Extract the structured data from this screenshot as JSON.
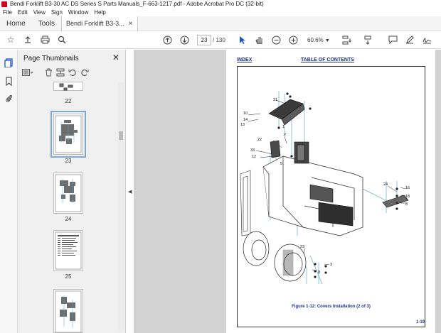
{
  "window": {
    "title": "Bendi Forklift  B3-30 AC DS Series S Parts Manuals_F-663-1217.pdf - Adobe Acrobat Pro DC (32-bit)"
  },
  "menu": [
    "File",
    "Edit",
    "View",
    "Sign",
    "Window",
    "Help"
  ],
  "tabs": {
    "home": "Home",
    "tools": "Tools",
    "doc": "Bendi Forklift  B3-3..."
  },
  "toolbar": {
    "page_current": "23",
    "page_total": "/   130",
    "zoom": "60.6%"
  },
  "panel": {
    "title": "Page Thumbnails",
    "thumbnails": [
      {
        "label": "22",
        "selected": false
      },
      {
        "label": "23",
        "selected": true
      },
      {
        "label": "24",
        "selected": false
      },
      {
        "label": "25",
        "selected": false
      },
      {
        "label": "",
        "selected": false
      }
    ]
  },
  "document": {
    "index_link": "INDEX",
    "toc_link": "TABLE OF CONTENTS",
    "caption": "Figure 1-12:  Covers Installation (2 of 3)",
    "page_number": "1-19",
    "callouts": [
      "31",
      "10",
      "14",
      "13",
      "1",
      "2",
      "22",
      "33",
      "12",
      "5",
      "24",
      "16",
      "18",
      "8",
      "23",
      "8",
      "3"
    ]
  },
  "colors": {
    "accent": "#1a2f9a",
    "selection": "#7fa7d6",
    "viewer_bg": "#d2d2d2"
  }
}
